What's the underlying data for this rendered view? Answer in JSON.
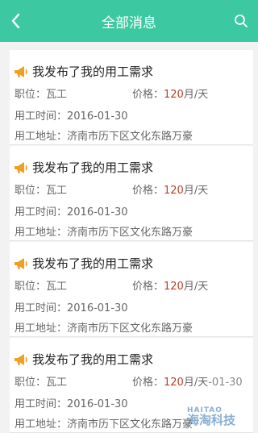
{
  "header": {
    "title": "全部消息"
  },
  "cards": [
    {
      "title": "我发布了我的用工需求",
      "position": "职位：瓦工",
      "price_label": "价格：",
      "price_value": "120",
      "price_unit": "月/天",
      "price_extra": "",
      "time": "用工时间：2016-01-30",
      "address": "用工地址：济南市历下区文化东路万豪"
    },
    {
      "title": "我发布了我的用工需求",
      "position": "职位：瓦工",
      "price_label": "价格：",
      "price_value": "120",
      "price_unit": "月/天",
      "price_extra": "",
      "time": "用工时间：2016-01-30",
      "address": "用工地址：济南市历下区文化东路万豪"
    },
    {
      "title": "我发布了我的用工需求",
      "position": "职位：瓦工",
      "price_label": "价格：",
      "price_value": "120",
      "price_unit": "月/天",
      "price_extra": "",
      "time": "用工时间：2016-01-30",
      "address": "用工地址：济南市历下区文化东路万豪"
    },
    {
      "title": "我发布了我的用工需求",
      "position": "职位：瓦工",
      "price_label": "价格：",
      "price_value": "120",
      "price_unit": "月/天",
      "price_extra": "-01-30",
      "time": "用工时间：2016-01-30",
      "address": "用工地址：济南市历下区文化东路万豪"
    }
  ],
  "watermark": {
    "top": "HAITAO",
    "bottom": "海淘科技"
  },
  "colors": {
    "header_bg": "#3cc9a1",
    "price_accent": "#c0392b",
    "megaphone": "#f0a020"
  },
  "icons": {
    "back": "chevron-left-icon",
    "search": "search-icon",
    "item": "megaphone-icon"
  }
}
